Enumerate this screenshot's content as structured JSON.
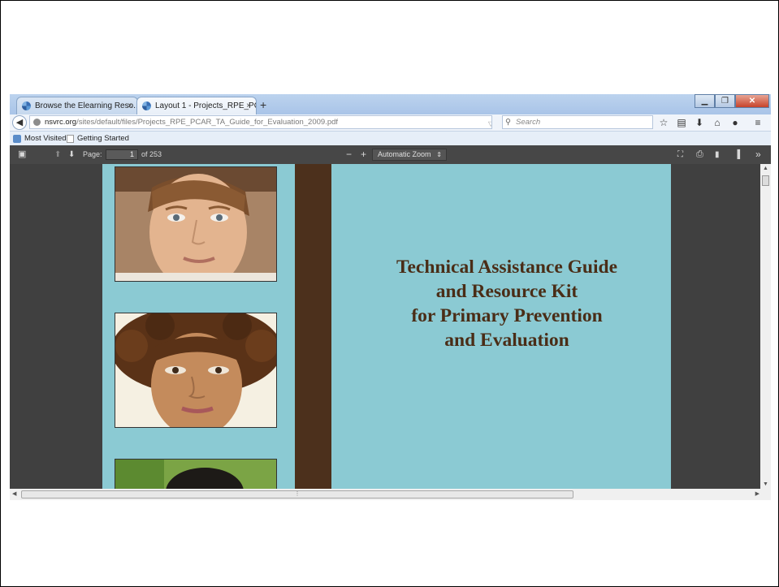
{
  "browser": {
    "tabs": [
      {
        "label": "Browse the Elearning Reso...",
        "close": "×"
      },
      {
        "label": "Layout 1 - Projects_RPE_PC...",
        "close": "×"
      }
    ],
    "new_tab": "+",
    "url_domain": "nsvrc.org",
    "url_path": "/sites/default/files/Projects_RPE_PCAR_TA_Guide_for_Evaluation_2009.pdf",
    "search_placeholder": "Search",
    "bookmarks": [
      "Most Visited",
      "Getting Started"
    ],
    "nav_icons": [
      "star-icon",
      "library-icon",
      "download-icon",
      "home-icon",
      "chat-icon",
      "menu-icon"
    ]
  },
  "pdf_toolbar": {
    "page_label": "Page:",
    "page_current": "1",
    "page_total": "of 253",
    "zoom_out": "−",
    "zoom_in": "+",
    "zoom_value": "Automatic Zoom",
    "tools_more": "»"
  },
  "document": {
    "title_lines": [
      "Technical Assistance Guide",
      "and Resource Kit",
      "for Primary Prevention",
      "and Evaluation"
    ],
    "colors": {
      "page": "#8bcad3",
      "strip": "#4c301c",
      "title": "#4a2d17"
    }
  }
}
